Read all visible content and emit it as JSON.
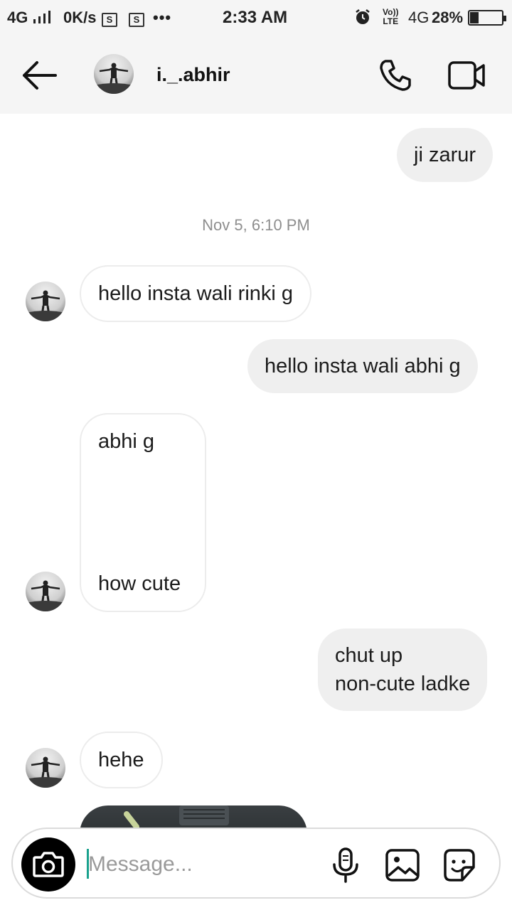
{
  "status_bar": {
    "network": "4G",
    "speed": "0K/s",
    "s_icon_label": "S",
    "more": "•••",
    "time": "2:33 AM",
    "volte": "Vo))\nLTE",
    "volte_top": "Vo))",
    "volte_bottom": "LTE",
    "network2": "4G",
    "battery": "28%",
    "battery_level_percent": 28
  },
  "header": {
    "username": "i._.abhir"
  },
  "messages": [
    {
      "side": "sent",
      "text": "ji zarur"
    },
    {
      "side": "timestamp",
      "text": "Nov 5, 6:10 PM"
    },
    {
      "side": "received",
      "text": "hello insta wali rinki g"
    },
    {
      "side": "sent",
      "text": "hello insta wali abhi g"
    },
    {
      "side": "received",
      "line1": "abhi g",
      "line2": "how cute"
    },
    {
      "side": "sent",
      "line1": "chut up",
      "line2": "non-cute ladke"
    },
    {
      "side": "received",
      "text": "hehe"
    }
  ],
  "composer": {
    "placeholder": "Message..."
  },
  "colors": {
    "sent_bubble": "#efefef",
    "received_border": "#ececec",
    "timestamp": "#8e8e8e",
    "cursor": "#19a18d"
  }
}
